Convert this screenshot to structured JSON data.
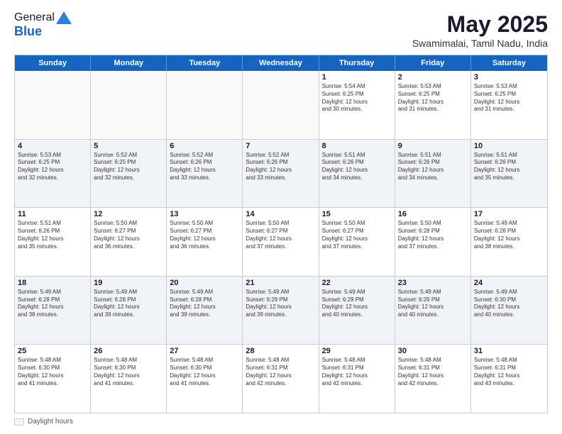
{
  "logo": {
    "general": "General",
    "blue": "Blue"
  },
  "title": "May 2025",
  "subtitle": "Swamimalai, Tamil Nadu, India",
  "days": [
    "Sunday",
    "Monday",
    "Tuesday",
    "Wednesday",
    "Thursday",
    "Friday",
    "Saturday"
  ],
  "weeks": [
    [
      {
        "day": "",
        "info": ""
      },
      {
        "day": "",
        "info": ""
      },
      {
        "day": "",
        "info": ""
      },
      {
        "day": "",
        "info": ""
      },
      {
        "day": "1",
        "info": "Sunrise: 5:54 AM\nSunset: 6:25 PM\nDaylight: 12 hours\nand 30 minutes."
      },
      {
        "day": "2",
        "info": "Sunrise: 5:53 AM\nSunset: 6:25 PM\nDaylight: 12 hours\nand 31 minutes."
      },
      {
        "day": "3",
        "info": "Sunrise: 5:53 AM\nSunset: 6:25 PM\nDaylight: 12 hours\nand 31 minutes."
      }
    ],
    [
      {
        "day": "4",
        "info": "Sunrise: 5:53 AM\nSunset: 6:25 PM\nDaylight: 12 hours\nand 32 minutes."
      },
      {
        "day": "5",
        "info": "Sunrise: 5:52 AM\nSunset: 6:25 PM\nDaylight: 12 hours\nand 32 minutes."
      },
      {
        "day": "6",
        "info": "Sunrise: 5:52 AM\nSunset: 6:26 PM\nDaylight: 12 hours\nand 33 minutes."
      },
      {
        "day": "7",
        "info": "Sunrise: 5:52 AM\nSunset: 6:26 PM\nDaylight: 12 hours\nand 33 minutes."
      },
      {
        "day": "8",
        "info": "Sunrise: 5:51 AM\nSunset: 6:26 PM\nDaylight: 12 hours\nand 34 minutes."
      },
      {
        "day": "9",
        "info": "Sunrise: 5:51 AM\nSunset: 6:26 PM\nDaylight: 12 hours\nand 34 minutes."
      },
      {
        "day": "10",
        "info": "Sunrise: 5:51 AM\nSunset: 6:26 PM\nDaylight: 12 hours\nand 35 minutes."
      }
    ],
    [
      {
        "day": "11",
        "info": "Sunrise: 5:51 AM\nSunset: 6:26 PM\nDaylight: 12 hours\nand 35 minutes."
      },
      {
        "day": "12",
        "info": "Sunrise: 5:50 AM\nSunset: 6:27 PM\nDaylight: 12 hours\nand 36 minutes."
      },
      {
        "day": "13",
        "info": "Sunrise: 5:50 AM\nSunset: 6:27 PM\nDaylight: 12 hours\nand 36 minutes."
      },
      {
        "day": "14",
        "info": "Sunrise: 5:50 AM\nSunset: 6:27 PM\nDaylight: 12 hours\nand 37 minutes."
      },
      {
        "day": "15",
        "info": "Sunrise: 5:50 AM\nSunset: 6:27 PM\nDaylight: 12 hours\nand 37 minutes."
      },
      {
        "day": "16",
        "info": "Sunrise: 5:50 AM\nSunset: 6:28 PM\nDaylight: 12 hours\nand 37 minutes."
      },
      {
        "day": "17",
        "info": "Sunrise: 5:49 AM\nSunset: 6:28 PM\nDaylight: 12 hours\nand 38 minutes."
      }
    ],
    [
      {
        "day": "18",
        "info": "Sunrise: 5:49 AM\nSunset: 6:28 PM\nDaylight: 12 hours\nand 38 minutes."
      },
      {
        "day": "19",
        "info": "Sunrise: 5:49 AM\nSunset: 6:28 PM\nDaylight: 12 hours\nand 39 minutes."
      },
      {
        "day": "20",
        "info": "Sunrise: 5:49 AM\nSunset: 6:28 PM\nDaylight: 12 hours\nand 39 minutes."
      },
      {
        "day": "21",
        "info": "Sunrise: 5:49 AM\nSunset: 6:29 PM\nDaylight: 12 hours\nand 39 minutes."
      },
      {
        "day": "22",
        "info": "Sunrise: 5:49 AM\nSunset: 6:29 PM\nDaylight: 12 hours\nand 40 minutes."
      },
      {
        "day": "23",
        "info": "Sunrise: 5:49 AM\nSunset: 6:29 PM\nDaylight: 12 hours\nand 40 minutes."
      },
      {
        "day": "24",
        "info": "Sunrise: 5:49 AM\nSunset: 6:30 PM\nDaylight: 12 hours\nand 40 minutes."
      }
    ],
    [
      {
        "day": "25",
        "info": "Sunrise: 5:48 AM\nSunset: 6:30 PM\nDaylight: 12 hours\nand 41 minutes."
      },
      {
        "day": "26",
        "info": "Sunrise: 5:48 AM\nSunset: 6:30 PM\nDaylight: 12 hours\nand 41 minutes."
      },
      {
        "day": "27",
        "info": "Sunrise: 5:48 AM\nSunset: 6:30 PM\nDaylight: 12 hours\nand 41 minutes."
      },
      {
        "day": "28",
        "info": "Sunrise: 5:48 AM\nSunset: 6:31 PM\nDaylight: 12 hours\nand 42 minutes."
      },
      {
        "day": "29",
        "info": "Sunrise: 5:48 AM\nSunset: 6:31 PM\nDaylight: 12 hours\nand 42 minutes."
      },
      {
        "day": "30",
        "info": "Sunrise: 5:48 AM\nSunset: 6:31 PM\nDaylight: 12 hours\nand 42 minutes."
      },
      {
        "day": "31",
        "info": "Sunrise: 5:48 AM\nSunset: 6:31 PM\nDaylight: 12 hours\nand 43 minutes."
      }
    ]
  ],
  "footer": {
    "legend": "Daylight hours"
  }
}
